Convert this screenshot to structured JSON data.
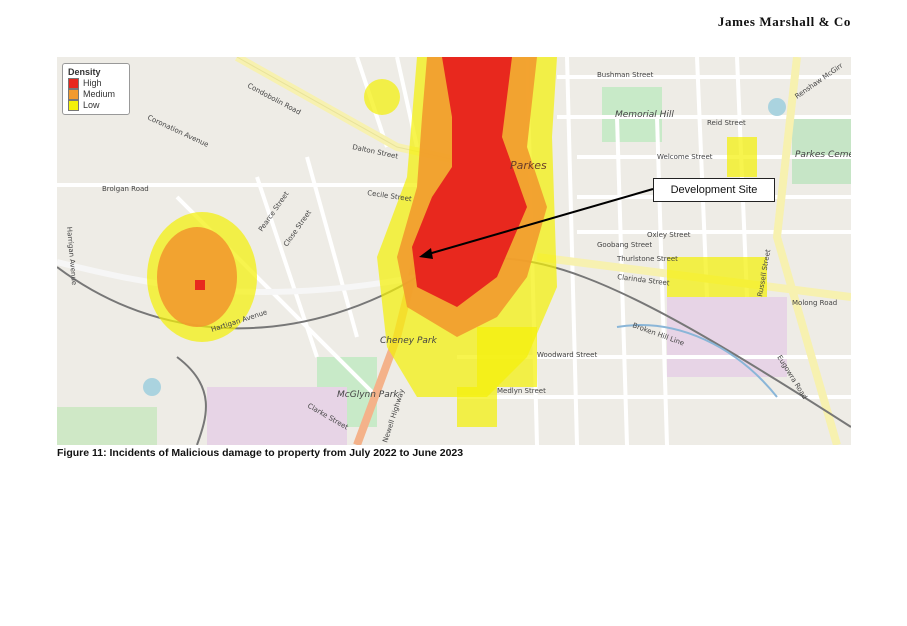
{
  "brand": "James Marshall & Co",
  "legend": {
    "title": "Density",
    "items": [
      {
        "label": "High",
        "color": "#e8281e"
      },
      {
        "label": "Medium",
        "color": "#f29a2e"
      },
      {
        "label": "Low",
        "color": "#f4f00a"
      }
    ]
  },
  "callout": "Development Site",
  "caption": "Figure 11:  Incidents of Malicious damage to property from July 2022 to June 2023",
  "streets": {
    "condobolin": "Condobolin Road",
    "dalton": "Dalton Street",
    "brolgan": "Brolgan Road",
    "coronation": "Coronation Avenue",
    "clarinda": "Clarinda Street",
    "molong": "Molong Road",
    "russell": "Russell Street",
    "renshaw": "Renshaw McGirr",
    "newell": "Newell Highway",
    "bushman": "Bushman Street",
    "reid": "Reid Street",
    "welcome": "Welcome Street",
    "oxley": "Oxley Street",
    "goobang": "Goobang Street",
    "thurlstone": "Thurlstone Street",
    "eugowra": "Eugowra Road",
    "harrigan": "Harrigan Avenue",
    "woodward": "Woodward Street",
    "medlyn": "Medlyn Street",
    "clarke": "Clarke Street",
    "cecile": "Cecile Street",
    "hartigan": "Hartigan Avenue",
    "brokenhill": "Broken Hill Line",
    "pearce": "Pearce Street",
    "close": "Close Street"
  },
  "places": {
    "parkes": "Parkes",
    "memorial": "Memorial Hill",
    "cheney": "Cheney Park",
    "mcglynn": "McGlynn Park",
    "cemetery": "Parkes Cemetery"
  }
}
